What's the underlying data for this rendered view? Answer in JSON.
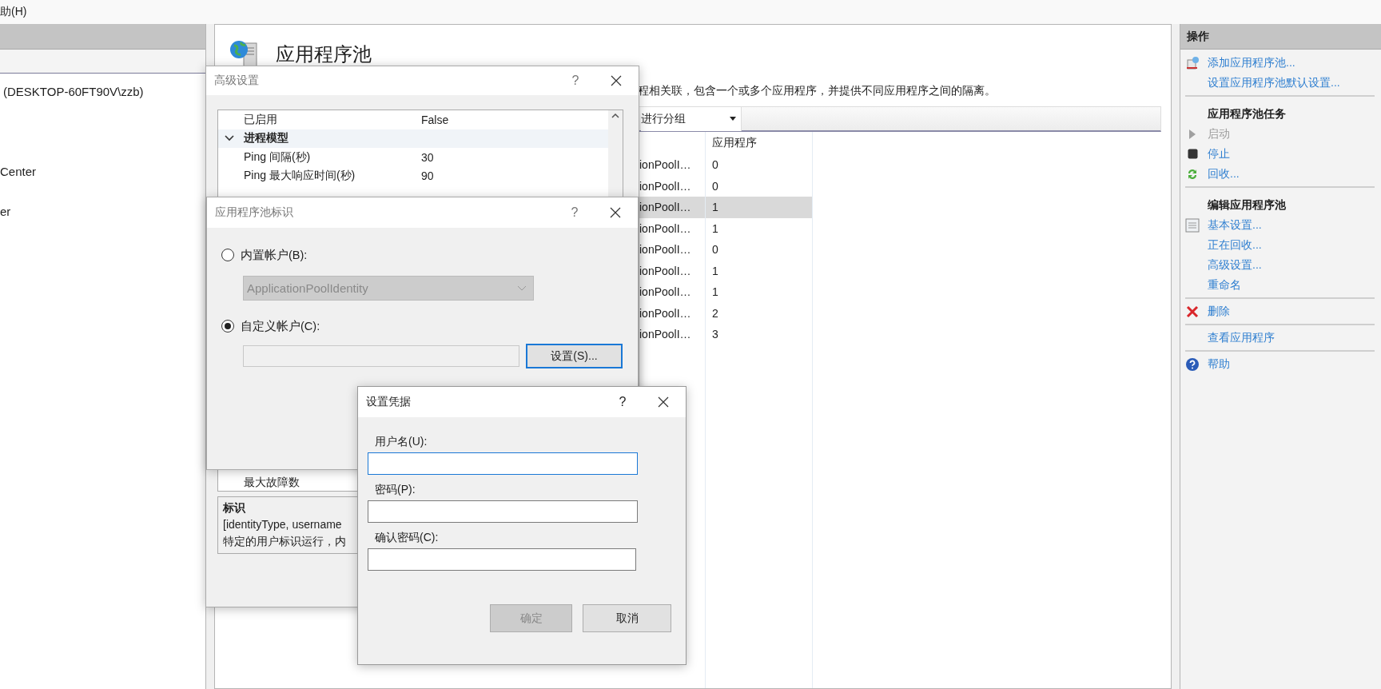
{
  "menu_bar": {
    "items": [
      "助(H)"
    ]
  },
  "connections_panel": {
    "tree_items": [
      {
        "label": "(DESKTOP-60FT90V\\zzb)"
      },
      {
        "label": "Center"
      },
      {
        "label": "er"
      }
    ]
  },
  "main": {
    "title": "应用程序池",
    "description": "程相关联，包含一个或多个应用程序，并提供不同应用程序之间的隔离。",
    "group_by": "进行分组",
    "table": {
      "header": "应用程序",
      "rows": [
        {
          "column_1": "ionPoolI…",
          "applications": "0",
          "selected": false
        },
        {
          "column_1": "ionPoolI…",
          "applications": "0",
          "selected": false
        },
        {
          "column_1": "ionPoolI…",
          "applications": "1",
          "selected": true
        },
        {
          "column_1": "ionPoolI…",
          "applications": "1",
          "selected": false
        },
        {
          "column_1": "ionPoolI…",
          "applications": "0",
          "selected": false
        },
        {
          "column_1": "ionPoolI…",
          "applications": "1",
          "selected": false
        },
        {
          "column_1": "ionPoolI…",
          "applications": "1",
          "selected": false
        },
        {
          "column_1": "ionPoolI…",
          "applications": "2",
          "selected": false
        },
        {
          "column_1": "ionPoolI…",
          "applications": "3",
          "selected": false
        }
      ]
    }
  },
  "actions_panel": {
    "title": "操作",
    "items": [
      {
        "kind": "link",
        "label": "添加应用程序池...",
        "disabled": false
      },
      {
        "kind": "link",
        "label": "设置应用程序池默认设置...",
        "disabled": false
      },
      {
        "kind": "separator"
      },
      {
        "kind": "header",
        "label": "应用程序池任务"
      },
      {
        "kind": "link",
        "label": "启动",
        "disabled": true
      },
      {
        "kind": "link",
        "label": "停止",
        "disabled": false
      },
      {
        "kind": "link",
        "label": "回收...",
        "disabled": false
      },
      {
        "kind": "separator"
      },
      {
        "kind": "header",
        "label": "编辑应用程序池"
      },
      {
        "kind": "link",
        "label": "基本设置...",
        "disabled": false
      },
      {
        "kind": "link",
        "label": "正在回收...",
        "disabled": false
      },
      {
        "kind": "link",
        "label": "高级设置...",
        "disabled": false
      },
      {
        "kind": "link",
        "label": "重命名",
        "disabled": false
      },
      {
        "kind": "separator"
      },
      {
        "kind": "link",
        "label": "删除",
        "disabled": false
      },
      {
        "kind": "separator"
      },
      {
        "kind": "link",
        "label": "查看应用程序",
        "disabled": false
      },
      {
        "kind": "separator"
      },
      {
        "kind": "link",
        "label": "帮助",
        "disabled": false
      }
    ]
  },
  "advanced_settings_dialog": {
    "title": "高级设置",
    "help_glyph": "?",
    "active": false,
    "rows": [
      {
        "kind": "property",
        "name": "已启用",
        "value": "False"
      },
      {
        "kind": "group",
        "name": "进程模型",
        "expanded": true
      },
      {
        "kind": "property",
        "name": "Ping 间隔(秒)",
        "value": "30"
      },
      {
        "kind": "property",
        "name": "Ping 最大响应时间(秒)",
        "value": "90"
      }
    ],
    "last_visible_row": {
      "name": "最大故障数"
    },
    "description": {
      "title": "标识",
      "lines": [
        "[identityType, username",
        "特定的用户标识运行，内"
      ]
    }
  },
  "identity_dialog": {
    "title": "应用程序池标识",
    "help_glyph": "?",
    "active": false,
    "builtin": {
      "label": "内置帐户(B):",
      "selected": false,
      "dropdown": {
        "value": "ApplicationPoolIdentity",
        "disabled": true
      }
    },
    "custom": {
      "label": "自定义帐户(C):",
      "selected": true,
      "button": {
        "label": "设置(S)...",
        "default": true
      }
    }
  },
  "credentials_dialog": {
    "title": "设置凭据",
    "help_glyph": "?",
    "active": true,
    "fields": [
      {
        "label": "用户名(U):",
        "focused": true
      },
      {
        "label": "密码(P):",
        "focused": false
      },
      {
        "label": "确认密码(C):",
        "focused": false
      }
    ],
    "buttons": [
      {
        "label": "确定",
        "disabled": true
      },
      {
        "label": "取消",
        "disabled": false
      }
    ]
  }
}
